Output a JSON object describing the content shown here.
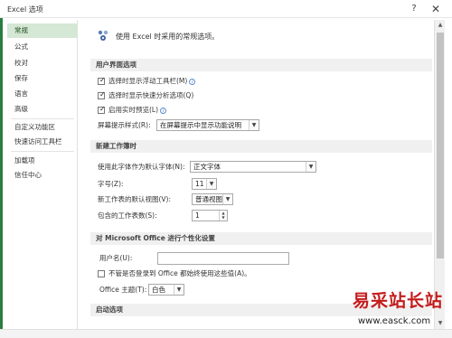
{
  "window": {
    "title": "Excel 选项",
    "help_glyph": "?",
    "close_glyph": "✕"
  },
  "sidebar": {
    "items": [
      {
        "label": "常规",
        "active": true
      },
      {
        "label": "公式"
      },
      {
        "label": "校对"
      },
      {
        "label": "保存"
      },
      {
        "label": "语言"
      },
      {
        "label": "高级"
      },
      {
        "label": "自定义功能区"
      },
      {
        "label": "快速访问工具栏"
      },
      {
        "label": "加载项"
      },
      {
        "label": "信任中心"
      }
    ]
  },
  "content": {
    "header_text": "使用 Excel 时采用的常规选项。",
    "header_icon": "options-gear-icon",
    "sections": {
      "ui_options": {
        "title": "用户界面选项",
        "show_mini_toolbar": {
          "label": "选择时显示浮动工具栏(M)",
          "checked": true
        },
        "show_quick_analysis": {
          "label": "选择时显示快速分析选项(Q)",
          "checked": true
        },
        "live_preview": {
          "label": "启用实时预览(L)",
          "checked": true
        },
        "screentip_style": {
          "label": "屏幕提示样式(R):",
          "value": "在屏幕提示中显示功能说明"
        }
      },
      "new_workbook": {
        "title": "新建工作簿时",
        "default_font": {
          "label": "使用此字体作为默认字体(N):",
          "value": "正文字体"
        },
        "font_size": {
          "label": "字号(Z):",
          "value": "11"
        },
        "default_view": {
          "label": "新工作表的默认视图(V):",
          "value": "普通视图"
        },
        "sheet_count": {
          "label": "包含的工作表数(S):",
          "value": "1"
        }
      },
      "personalize": {
        "title": "对 Microsoft Office 进行个性化设置",
        "user_name": {
          "label": "用户名(U):",
          "value": ""
        },
        "always_use_values": {
          "label": "不管是否登录到 Office 都始终使用这些值(A)。",
          "checked": false
        },
        "office_theme": {
          "label": "Office 主题(T):",
          "value": "白色"
        }
      },
      "startup": {
        "title": "启动选项"
      }
    }
  },
  "watermark": {
    "title": "易采站长站",
    "url": "www.easck.com"
  },
  "colors": {
    "accent_green": "#2a7d3f",
    "active_nav_bg": "#d5e7d5",
    "watermark_red": "#c41b1b"
  }
}
